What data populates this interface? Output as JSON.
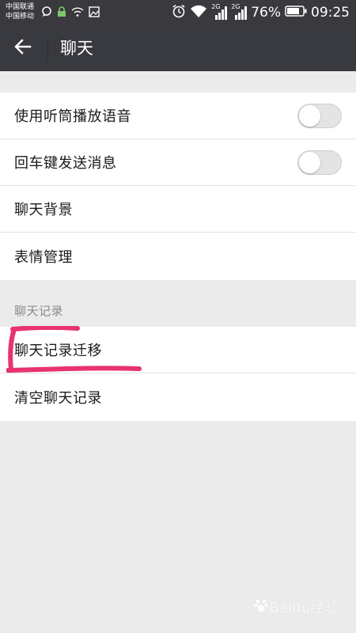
{
  "status_bar": {
    "carrier_1": "中国联通",
    "carrier_2": "中国移动",
    "network_tag_1": "2G",
    "network_tag_2": "2G",
    "battery_percent": "76%",
    "time": "09:25"
  },
  "header": {
    "title": "聊天"
  },
  "group_1": {
    "items": [
      {
        "label": "使用听筒播放语音",
        "toggle": false
      },
      {
        "label": "回车键发送消息",
        "toggle": false
      },
      {
        "label": "聊天背景"
      },
      {
        "label": "表情管理"
      }
    ]
  },
  "section_header": "聊天记录",
  "group_2": {
    "items": [
      {
        "label": "聊天记录迁移"
      },
      {
        "label": "清空聊天记录"
      }
    ]
  },
  "watermark": "Baidu经验",
  "colors": {
    "status_bar_bg": "#3a3a3e",
    "title_bar_bg": "#393a3f",
    "page_bg": "#ebebeb",
    "highlight_annotation": "#e8336d"
  }
}
